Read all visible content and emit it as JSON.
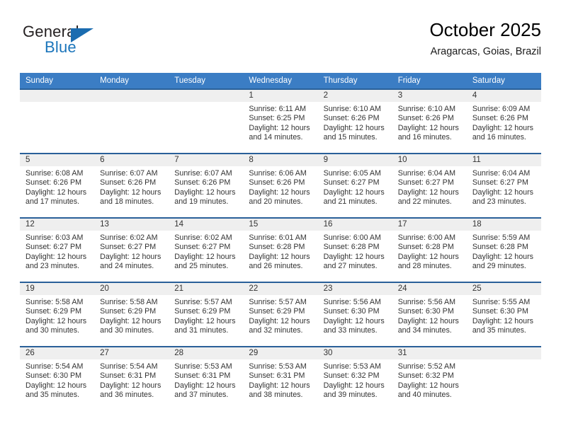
{
  "brand": {
    "word1": "General",
    "word2": "Blue",
    "flag_icon": "triangle-flag-icon"
  },
  "header": {
    "title": "October 2025",
    "subtitle": "Aragarcas, Goias, Brazil"
  },
  "colors": {
    "header_blue": "#3b7dc4",
    "row_divider_blue": "#2a6099",
    "daynum_band": "#efefef",
    "brand_blue": "#1b75bb",
    "text": "#333333"
  },
  "weekday_headers": [
    "Sunday",
    "Monday",
    "Tuesday",
    "Wednesday",
    "Thursday",
    "Friday",
    "Saturday"
  ],
  "weeks": [
    [
      {
        "day": "",
        "empty": true
      },
      {
        "day": "",
        "empty": true
      },
      {
        "day": "",
        "empty": true
      },
      {
        "day": "1",
        "sunrise": "Sunrise: 6:11 AM",
        "sunset": "Sunset: 6:25 PM",
        "daylight1": "Daylight: 12 hours",
        "daylight2": "and 14 minutes."
      },
      {
        "day": "2",
        "sunrise": "Sunrise: 6:10 AM",
        "sunset": "Sunset: 6:26 PM",
        "daylight1": "Daylight: 12 hours",
        "daylight2": "and 15 minutes."
      },
      {
        "day": "3",
        "sunrise": "Sunrise: 6:10 AM",
        "sunset": "Sunset: 6:26 PM",
        "daylight1": "Daylight: 12 hours",
        "daylight2": "and 16 minutes."
      },
      {
        "day": "4",
        "sunrise": "Sunrise: 6:09 AM",
        "sunset": "Sunset: 6:26 PM",
        "daylight1": "Daylight: 12 hours",
        "daylight2": "and 16 minutes."
      }
    ],
    [
      {
        "day": "5",
        "sunrise": "Sunrise: 6:08 AM",
        "sunset": "Sunset: 6:26 PM",
        "daylight1": "Daylight: 12 hours",
        "daylight2": "and 17 minutes."
      },
      {
        "day": "6",
        "sunrise": "Sunrise: 6:07 AM",
        "sunset": "Sunset: 6:26 PM",
        "daylight1": "Daylight: 12 hours",
        "daylight2": "and 18 minutes."
      },
      {
        "day": "7",
        "sunrise": "Sunrise: 6:07 AM",
        "sunset": "Sunset: 6:26 PM",
        "daylight1": "Daylight: 12 hours",
        "daylight2": "and 19 minutes."
      },
      {
        "day": "8",
        "sunrise": "Sunrise: 6:06 AM",
        "sunset": "Sunset: 6:26 PM",
        "daylight1": "Daylight: 12 hours",
        "daylight2": "and 20 minutes."
      },
      {
        "day": "9",
        "sunrise": "Sunrise: 6:05 AM",
        "sunset": "Sunset: 6:27 PM",
        "daylight1": "Daylight: 12 hours",
        "daylight2": "and 21 minutes."
      },
      {
        "day": "10",
        "sunrise": "Sunrise: 6:04 AM",
        "sunset": "Sunset: 6:27 PM",
        "daylight1": "Daylight: 12 hours",
        "daylight2": "and 22 minutes."
      },
      {
        "day": "11",
        "sunrise": "Sunrise: 6:04 AM",
        "sunset": "Sunset: 6:27 PM",
        "daylight1": "Daylight: 12 hours",
        "daylight2": "and 23 minutes."
      }
    ],
    [
      {
        "day": "12",
        "sunrise": "Sunrise: 6:03 AM",
        "sunset": "Sunset: 6:27 PM",
        "daylight1": "Daylight: 12 hours",
        "daylight2": "and 23 minutes."
      },
      {
        "day": "13",
        "sunrise": "Sunrise: 6:02 AM",
        "sunset": "Sunset: 6:27 PM",
        "daylight1": "Daylight: 12 hours",
        "daylight2": "and 24 minutes."
      },
      {
        "day": "14",
        "sunrise": "Sunrise: 6:02 AM",
        "sunset": "Sunset: 6:27 PM",
        "daylight1": "Daylight: 12 hours",
        "daylight2": "and 25 minutes."
      },
      {
        "day": "15",
        "sunrise": "Sunrise: 6:01 AM",
        "sunset": "Sunset: 6:28 PM",
        "daylight1": "Daylight: 12 hours",
        "daylight2": "and 26 minutes."
      },
      {
        "day": "16",
        "sunrise": "Sunrise: 6:00 AM",
        "sunset": "Sunset: 6:28 PM",
        "daylight1": "Daylight: 12 hours",
        "daylight2": "and 27 minutes."
      },
      {
        "day": "17",
        "sunrise": "Sunrise: 6:00 AM",
        "sunset": "Sunset: 6:28 PM",
        "daylight1": "Daylight: 12 hours",
        "daylight2": "and 28 minutes."
      },
      {
        "day": "18",
        "sunrise": "Sunrise: 5:59 AM",
        "sunset": "Sunset: 6:28 PM",
        "daylight1": "Daylight: 12 hours",
        "daylight2": "and 29 minutes."
      }
    ],
    [
      {
        "day": "19",
        "sunrise": "Sunrise: 5:58 AM",
        "sunset": "Sunset: 6:29 PM",
        "daylight1": "Daylight: 12 hours",
        "daylight2": "and 30 minutes."
      },
      {
        "day": "20",
        "sunrise": "Sunrise: 5:58 AM",
        "sunset": "Sunset: 6:29 PM",
        "daylight1": "Daylight: 12 hours",
        "daylight2": "and 30 minutes."
      },
      {
        "day": "21",
        "sunrise": "Sunrise: 5:57 AM",
        "sunset": "Sunset: 6:29 PM",
        "daylight1": "Daylight: 12 hours",
        "daylight2": "and 31 minutes."
      },
      {
        "day": "22",
        "sunrise": "Sunrise: 5:57 AM",
        "sunset": "Sunset: 6:29 PM",
        "daylight1": "Daylight: 12 hours",
        "daylight2": "and 32 minutes."
      },
      {
        "day": "23",
        "sunrise": "Sunrise: 5:56 AM",
        "sunset": "Sunset: 6:30 PM",
        "daylight1": "Daylight: 12 hours",
        "daylight2": "and 33 minutes."
      },
      {
        "day": "24",
        "sunrise": "Sunrise: 5:56 AM",
        "sunset": "Sunset: 6:30 PM",
        "daylight1": "Daylight: 12 hours",
        "daylight2": "and 34 minutes."
      },
      {
        "day": "25",
        "sunrise": "Sunrise: 5:55 AM",
        "sunset": "Sunset: 6:30 PM",
        "daylight1": "Daylight: 12 hours",
        "daylight2": "and 35 minutes."
      }
    ],
    [
      {
        "day": "26",
        "sunrise": "Sunrise: 5:54 AM",
        "sunset": "Sunset: 6:30 PM",
        "daylight1": "Daylight: 12 hours",
        "daylight2": "and 35 minutes."
      },
      {
        "day": "27",
        "sunrise": "Sunrise: 5:54 AM",
        "sunset": "Sunset: 6:31 PM",
        "daylight1": "Daylight: 12 hours",
        "daylight2": "and 36 minutes."
      },
      {
        "day": "28",
        "sunrise": "Sunrise: 5:53 AM",
        "sunset": "Sunset: 6:31 PM",
        "daylight1": "Daylight: 12 hours",
        "daylight2": "and 37 minutes."
      },
      {
        "day": "29",
        "sunrise": "Sunrise: 5:53 AM",
        "sunset": "Sunset: 6:31 PM",
        "daylight1": "Daylight: 12 hours",
        "daylight2": "and 38 minutes."
      },
      {
        "day": "30",
        "sunrise": "Sunrise: 5:53 AM",
        "sunset": "Sunset: 6:32 PM",
        "daylight1": "Daylight: 12 hours",
        "daylight2": "and 39 minutes."
      },
      {
        "day": "31",
        "sunrise": "Sunrise: 5:52 AM",
        "sunset": "Sunset: 6:32 PM",
        "daylight1": "Daylight: 12 hours",
        "daylight2": "and 40 minutes."
      },
      {
        "day": "",
        "empty": true
      }
    ]
  ]
}
